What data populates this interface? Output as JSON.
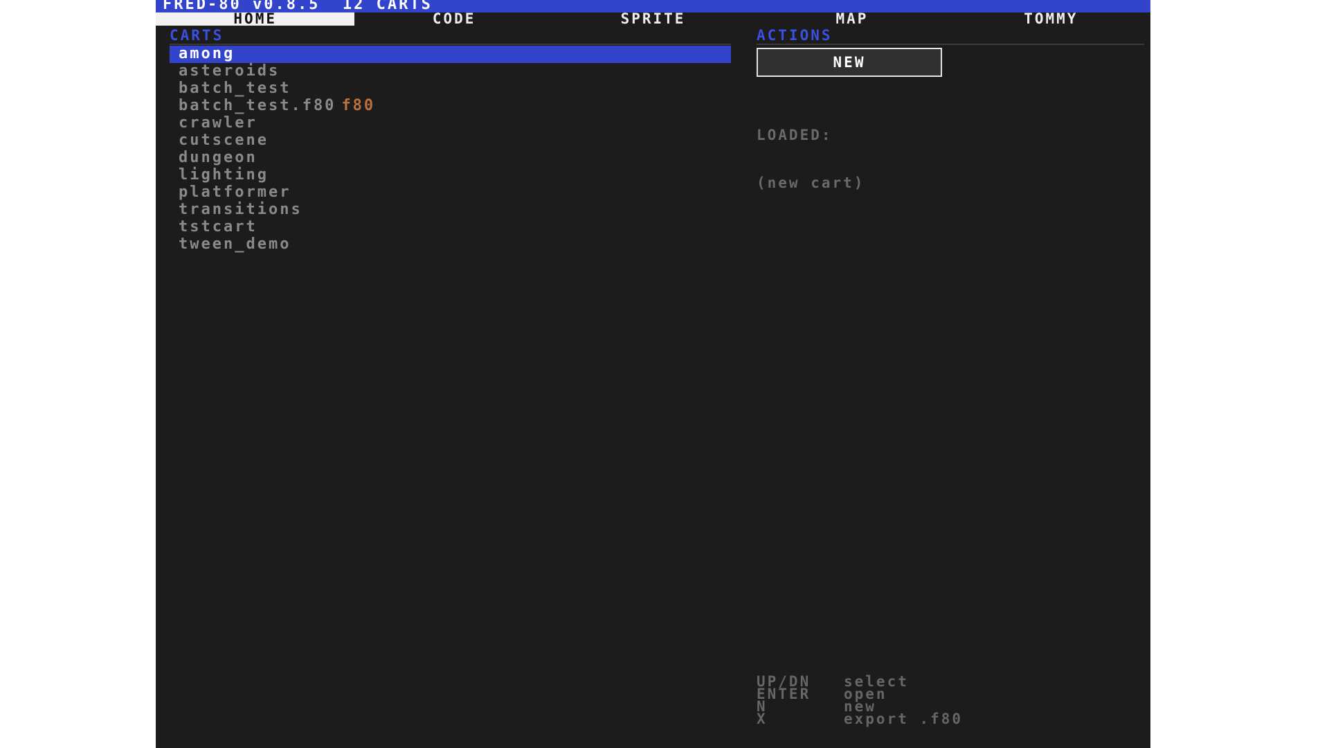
{
  "titlebar": {
    "title": "FRED-80 v0.8.5  12 CARTS"
  },
  "tabs": [
    {
      "label": "HOME",
      "active": true
    },
    {
      "label": "CODE"
    },
    {
      "label": "SPRITE"
    },
    {
      "label": "MAP"
    },
    {
      "label": "TOMMY"
    }
  ],
  "carts": {
    "heading": "CARTS",
    "items": [
      {
        "name": "among",
        "selected": true
      },
      {
        "name": "asteroids"
      },
      {
        "name": "batch_test"
      },
      {
        "name": "batch_test.f80",
        "badge": "f80"
      },
      {
        "name": "crawler"
      },
      {
        "name": "cutscene"
      },
      {
        "name": "dungeon"
      },
      {
        "name": "lighting"
      },
      {
        "name": "platformer"
      },
      {
        "name": "transitions"
      },
      {
        "name": "tstcart"
      },
      {
        "name": "tween_demo"
      }
    ]
  },
  "actions": {
    "heading": "ACTIONS",
    "new_label": "NEW",
    "loaded_label": "LOADED:",
    "loaded_value": "(new cart)"
  },
  "help": [
    {
      "key": "UP/DN",
      "desc": "select"
    },
    {
      "key": "ENTER",
      "desc": "open"
    },
    {
      "key": "N",
      "desc": "new"
    },
    {
      "key": "X",
      "desc": "export .f80"
    }
  ],
  "colors": {
    "accent": "#3344cc",
    "heading": "#3a50e0",
    "background": "#1c1c1c",
    "badge": "#c0703a",
    "muted_text": "#8a8a8a"
  }
}
